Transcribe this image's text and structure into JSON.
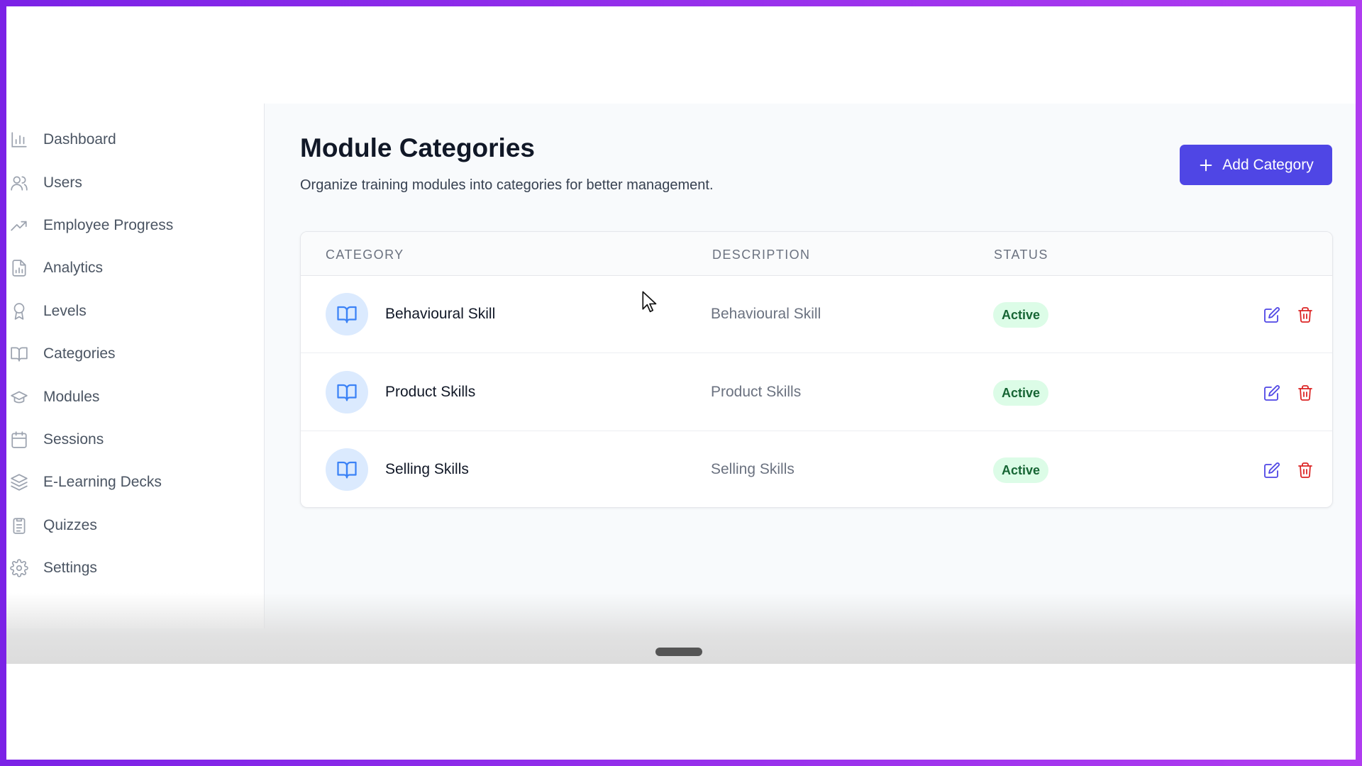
{
  "sidebar": {
    "items": [
      {
        "label": "Dashboard",
        "icon": "bar-chart-icon"
      },
      {
        "label": "Users",
        "icon": "users-icon"
      },
      {
        "label": "Employee Progress",
        "icon": "trending-up-icon"
      },
      {
        "label": "Analytics",
        "icon": "file-chart-icon"
      },
      {
        "label": "Levels",
        "icon": "award-icon"
      },
      {
        "label": "Categories",
        "icon": "book-open-icon"
      },
      {
        "label": "Modules",
        "icon": "graduation-cap-icon"
      },
      {
        "label": "Sessions",
        "icon": "calendar-icon"
      },
      {
        "label": "E-Learning Decks",
        "icon": "layers-icon"
      },
      {
        "label": "Quizzes",
        "icon": "clipboard-list-icon"
      },
      {
        "label": "Settings",
        "icon": "gear-icon"
      }
    ]
  },
  "header": {
    "title": "Module Categories",
    "subtitle": "Organize training modules into categories for better management.",
    "add_button_label": "Add Category"
  },
  "table": {
    "columns": [
      "CATEGORY",
      "DESCRIPTION",
      "STATUS"
    ],
    "rows": [
      {
        "name": "Behavioural Skill",
        "description": "Behavioural Skill",
        "status": "Active"
      },
      {
        "name": "Product Skills",
        "description": "Product Skills",
        "status": "Active"
      },
      {
        "name": "Selling Skills",
        "description": "Selling Skills",
        "status": "Active"
      }
    ]
  },
  "colors": {
    "accent": "#4f46e5",
    "status_active_bg": "#dcfce7",
    "status_active_text": "#166534",
    "category_icon": "#3b82f6",
    "delete": "#dc2626",
    "edit": "#4f46e5",
    "frame": "#8b2be8"
  }
}
